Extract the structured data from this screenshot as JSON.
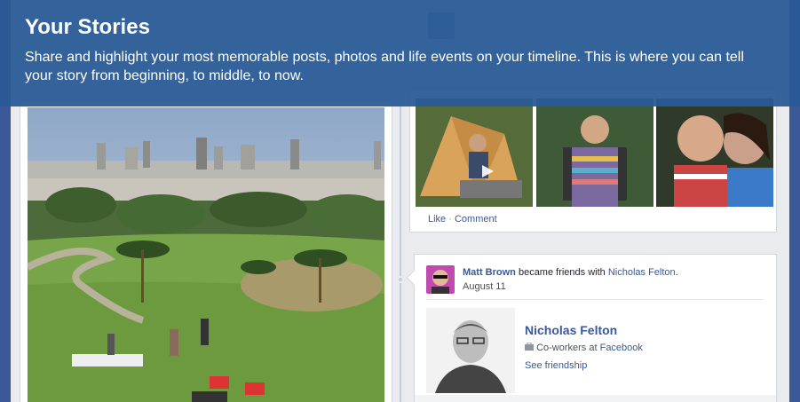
{
  "overlay": {
    "title": "Your Stories",
    "description": "Share and highlight your most memorable posts, photos and life events on your timeline. This is where you can tell your story from beginning, to middle, to now."
  },
  "photo_post": {
    "like_label": "Like",
    "separator": "·",
    "comment_label": "Comment"
  },
  "friend_story": {
    "actor": "Matt Brown",
    "verb": "became friends with",
    "target": "Nicholas Felton",
    "end_punct": ".",
    "date": "August 11",
    "friend_name": "Nicholas Felton",
    "work_prefix": "Co-workers at",
    "work_company": "Facebook",
    "see_friendship": "See friendship"
  },
  "colors": {
    "overlay": "#285a96",
    "link": "#3b5998",
    "background": "#e9ebee"
  },
  "icons": {
    "work": "briefcase-icon"
  }
}
